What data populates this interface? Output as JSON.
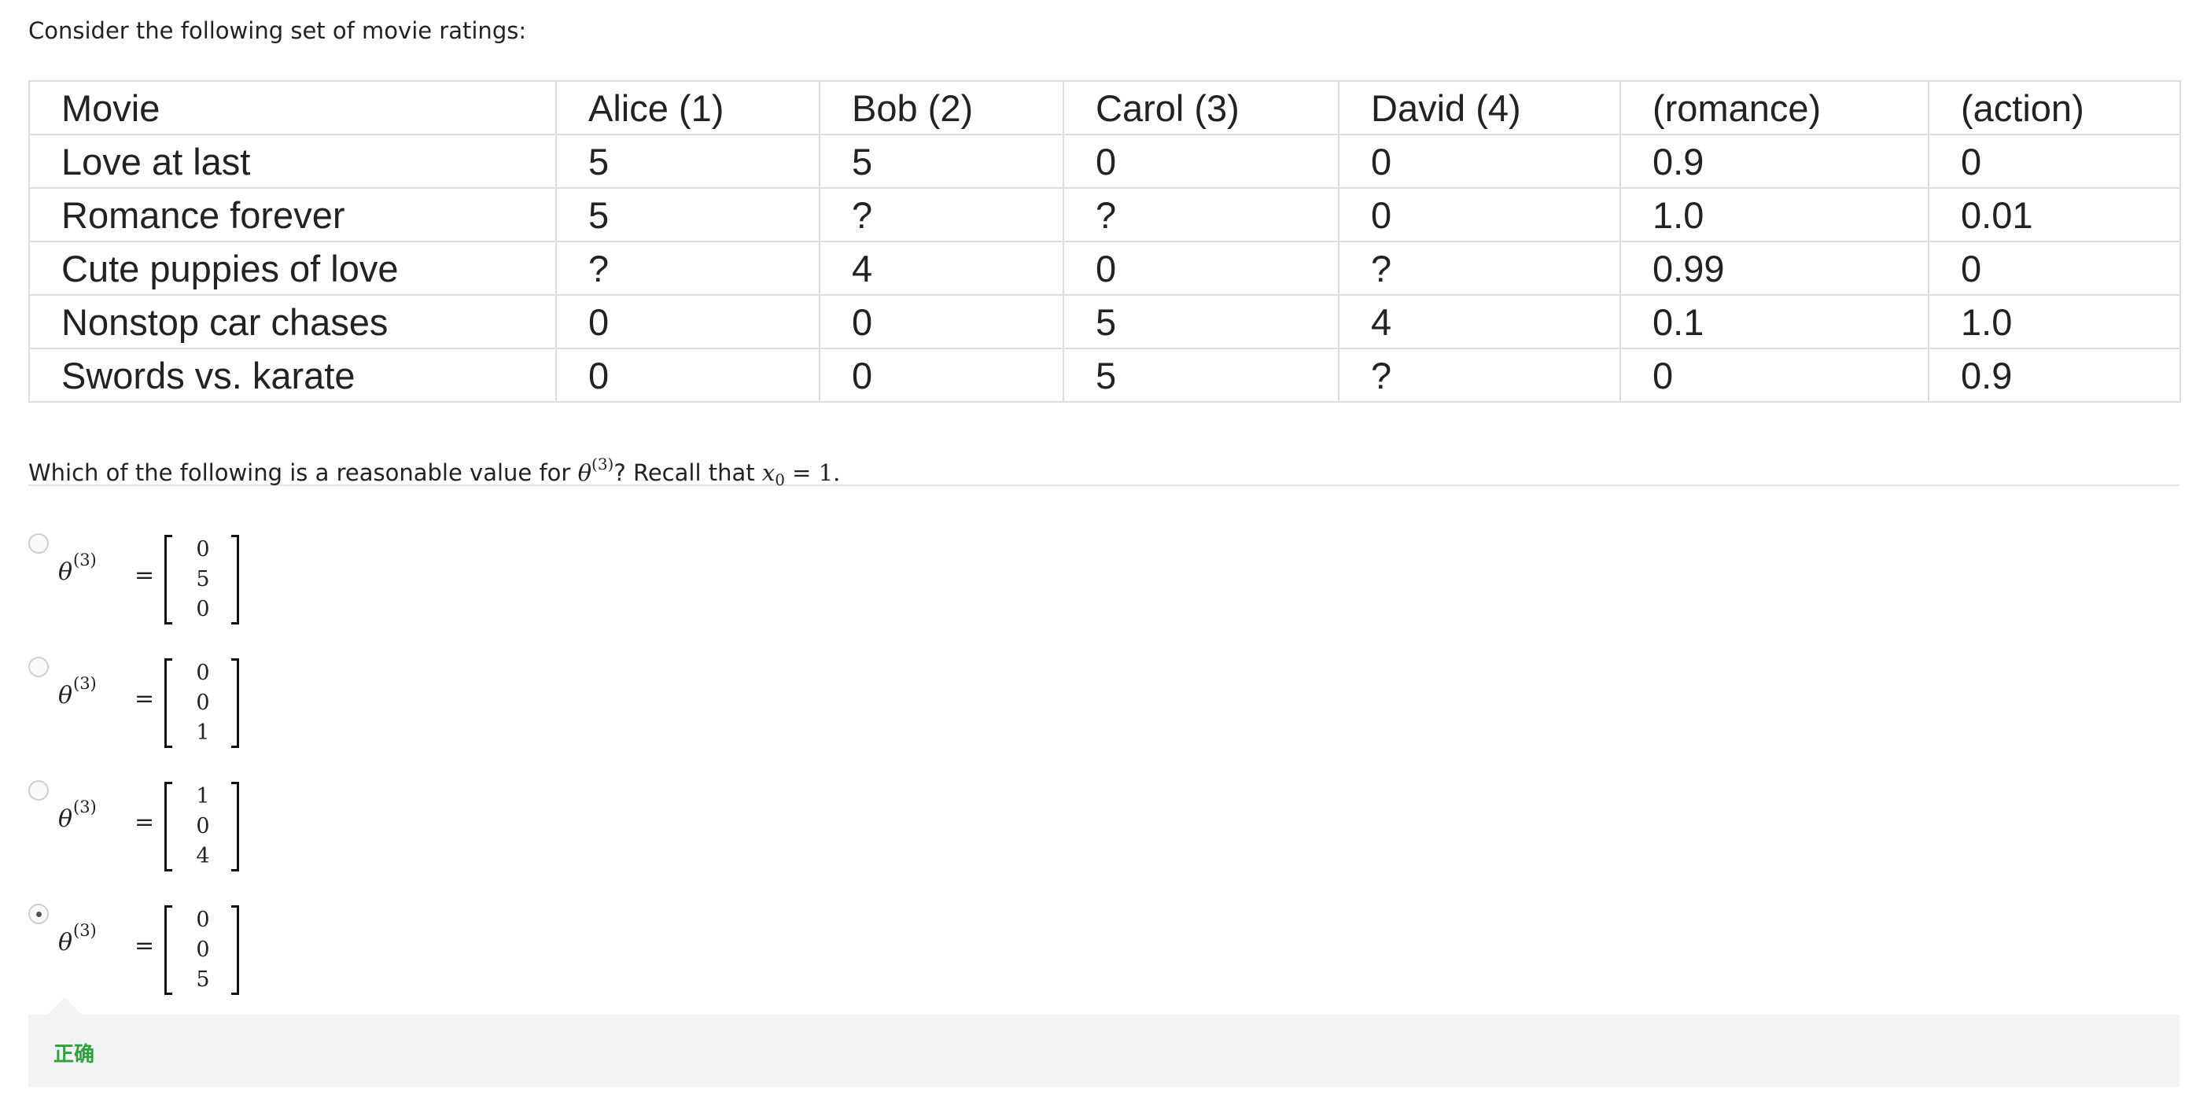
{
  "intro": "Consider the following set of movie ratings:",
  "table": {
    "headers": [
      "Movie",
      "Alice (1)",
      "Bob (2)",
      "Carol (3)",
      "David (4)",
      "(romance)",
      "(action)"
    ],
    "rows": [
      [
        "Love at last",
        "5",
        "5",
        "0",
        "0",
        "0.9",
        "0"
      ],
      [
        "Romance forever",
        "5",
        "?",
        "?",
        "0",
        "1.0",
        "0.01"
      ],
      [
        "Cute puppies of love",
        "?",
        "4",
        "0",
        "?",
        "0.99",
        "0"
      ],
      [
        "Nonstop car chases",
        "0",
        "0",
        "5",
        "4",
        "0.1",
        "1.0"
      ],
      [
        "Swords vs. karate",
        "0",
        "0",
        "5",
        "?",
        "0",
        "0.9"
      ]
    ]
  },
  "question": {
    "prefix": "Which of the following is a reasonable value for ",
    "theta": "θ",
    "theta_sup": "(3)",
    "middle": "? Recall that ",
    "x": "x",
    "x_sub": "0",
    "equals": " = ",
    "one": "1",
    "end": "."
  },
  "options": [
    {
      "theta": "θ",
      "sup": "(3)",
      "equals": "=",
      "vector": [
        "0",
        "5",
        "0"
      ],
      "selected": false
    },
    {
      "theta": "θ",
      "sup": "(3)",
      "equals": "=",
      "vector": [
        "0",
        "0",
        "1"
      ],
      "selected": false
    },
    {
      "theta": "θ",
      "sup": "(3)",
      "equals": "=",
      "vector": [
        "1",
        "0",
        "4"
      ],
      "selected": false
    },
    {
      "theta": "θ",
      "sup": "(3)",
      "equals": "=",
      "vector": [
        "0",
        "0",
        "5"
      ],
      "selected": true
    }
  ],
  "feedback": {
    "text": "正确",
    "color": "#2aa33b"
  }
}
